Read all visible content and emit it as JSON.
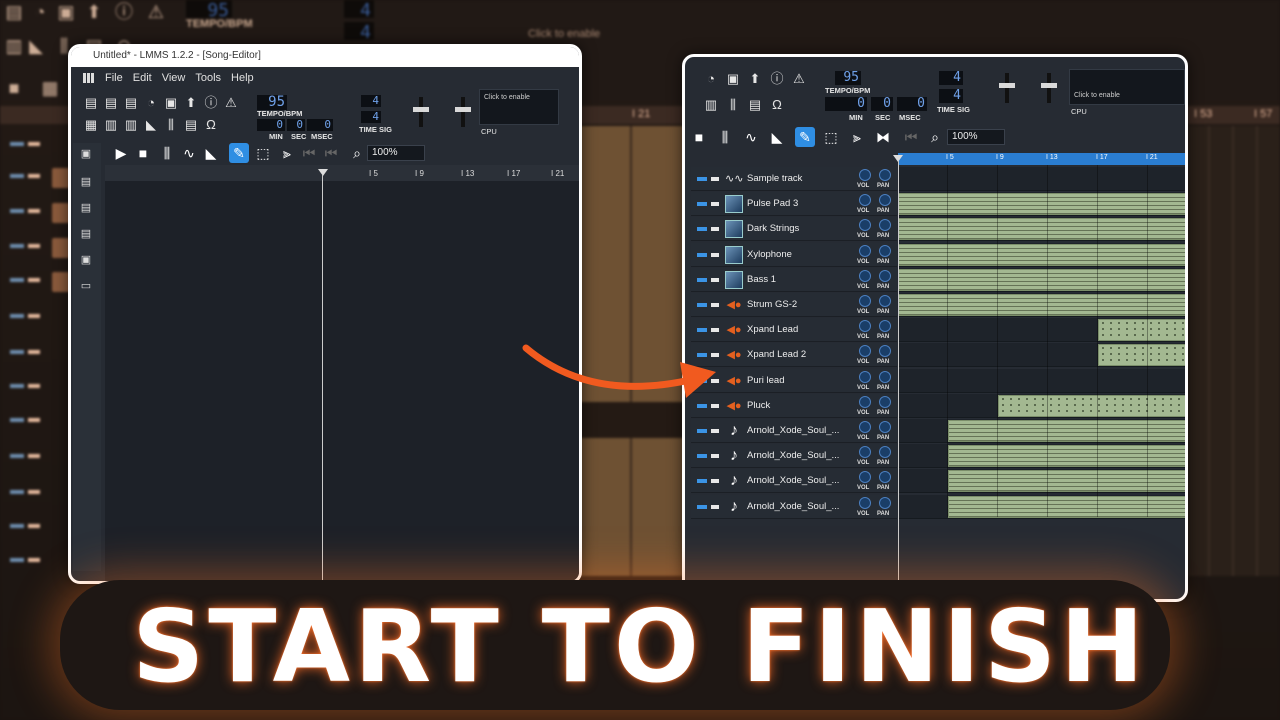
{
  "background": {
    "lcd_tempo": "95",
    "lcd_a": "4",
    "lcd_b": "4",
    "tempo_label": "TEMPO/BPM",
    "click_to_enable": "Click to enable",
    "ruler_marks": [
      "I 21",
      "I 53",
      "I 57"
    ]
  },
  "window1": {
    "title": "Untitled* - LMMS 1.2.2 - [Song-Editor]",
    "menu": [
      "File",
      "Edit",
      "View",
      "Tools",
      "Help"
    ],
    "tempo": "95",
    "tempo_label": "TEMPO/BPM",
    "min": "0",
    "sec": "0",
    "msec": "0",
    "min_label": "MIN",
    "sec_label": "SEC",
    "msec_label": "MSEC",
    "timesig_top": "4",
    "timesig_bottom": "4",
    "timesig_label": "TIME SIG",
    "click_to_enable": "Click to enable",
    "cpu_label": "CPU",
    "zoom": "100%",
    "ruler": [
      "I 5",
      "I 9",
      "I 13",
      "I 17",
      "I 21"
    ]
  },
  "window2": {
    "tempo": "95",
    "tempo_label": "TEMPO/BPM",
    "min": "0",
    "sec": "0",
    "msec": "0",
    "min_label": "MIN",
    "sec_label": "SEC",
    "msec_label": "MSEC",
    "timesig_top": "4",
    "timesig_bottom": "4",
    "timesig_label": "TIME SIG",
    "click_to_enable": "Click to enable",
    "cpu_label": "CPU",
    "zoom": "100%",
    "ruler": [
      "I 5",
      "I 9",
      "I 13",
      "I 17",
      "I 21"
    ],
    "vol_label": "VOL",
    "pan_label": "PAN",
    "tracks": [
      {
        "name": "Sample track",
        "icon": "waveform-icon",
        "clips": []
      },
      {
        "name": "Pulse Pad 3",
        "icon": "instrument-image-icon",
        "clips": [
          [
            0,
            1,
            "pat"
          ]
        ]
      },
      {
        "name": "Dark Strings",
        "icon": "instrument-image-icon",
        "clips": [
          [
            0,
            1,
            "pat"
          ]
        ]
      },
      {
        "name": "Xylophone",
        "icon": "instrument-image-icon",
        "clips": [
          [
            0,
            1,
            "pat"
          ]
        ]
      },
      {
        "name": "Bass 1",
        "icon": "instrument-image-icon",
        "clips": [
          [
            0,
            1,
            "pat"
          ]
        ]
      },
      {
        "name": "Strum GS-2",
        "icon": "plugin-orange-icon",
        "clips": [
          [
            0,
            1,
            "pat"
          ]
        ]
      },
      {
        "name": "Xpand Lead",
        "icon": "plugin-orange-icon",
        "clips": [
          [
            0.69,
            1,
            "dots"
          ]
        ]
      },
      {
        "name": "Xpand Lead 2",
        "icon": "plugin-orange-icon",
        "clips": [
          [
            0.69,
            1,
            "dots"
          ]
        ]
      },
      {
        "name": "Puri lead",
        "icon": "plugin-orange-icon",
        "clips": []
      },
      {
        "name": "Pluck",
        "icon": "plugin-orange-icon",
        "clips": [
          [
            0.345,
            1,
            "dots"
          ]
        ]
      },
      {
        "name": "Arnold_Xode_Soul_...",
        "icon": "music-note-icon",
        "clips": [
          [
            0.172,
            1,
            "pat"
          ]
        ]
      },
      {
        "name": "Arnold_Xode_Soul_...",
        "icon": "music-note-icon",
        "clips": [
          [
            0.172,
            1,
            "pat"
          ]
        ]
      },
      {
        "name": "Arnold_Xode_Soul_...",
        "icon": "music-note-icon",
        "clips": [
          [
            0.172,
            1,
            "pat"
          ]
        ]
      },
      {
        "name": "Arnold_Xode_Soul_...",
        "icon": "music-note-icon",
        "clips": [
          [
            0.172,
            1,
            "pat"
          ]
        ]
      }
    ]
  },
  "banner": {
    "text": "START TO FINISH"
  },
  "colors": {
    "accent": "#2f8ee3",
    "clip": "#a3b891",
    "glow": "#ff7a30",
    "arrow": "#f15a1f"
  }
}
